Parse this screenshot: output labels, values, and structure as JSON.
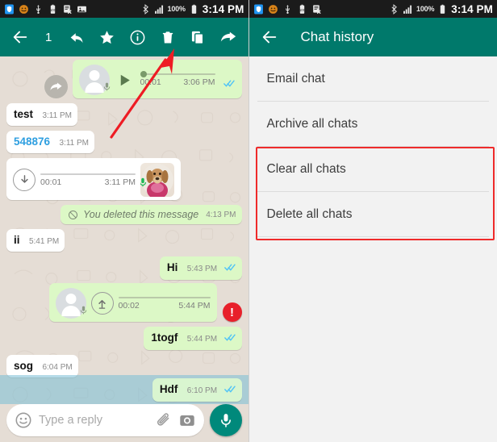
{
  "status_bar": {
    "battery_percent": "100%",
    "time": "3:14 PM",
    "icons_left": [
      "shield-icon",
      "smiley-icon",
      "usb-icon",
      "battery-saver-icon",
      "document-x-icon",
      "image-icon"
    ],
    "icons_right": [
      "bluetooth-icon",
      "signal-icon",
      "battery-icon"
    ]
  },
  "left_panel": {
    "action_bar": {
      "selected_count": "1",
      "icons": [
        "back-arrow-icon",
        "reply-icon",
        "star-icon",
        "info-icon",
        "delete-icon",
        "copy-icon",
        "forward-icon"
      ]
    },
    "accent_color": "#00796b",
    "messages": [
      {
        "id": "voice-out-1",
        "type": "voice-out",
        "forwarded": true,
        "duration": "00:01",
        "time": "3:06 PM",
        "status": "read"
      },
      {
        "id": "msg-test",
        "type": "text-in",
        "text": "test",
        "time": "3:11 PM"
      },
      {
        "id": "msg-548876",
        "type": "text-in-link",
        "text": "548876",
        "time": "3:11 PM"
      },
      {
        "id": "voice-in-1",
        "type": "voice-in",
        "duration": "00:01",
        "time": "3:11 PM",
        "avatar": "dog-photo-avatar"
      },
      {
        "id": "msg-deleted",
        "type": "deleted-out",
        "text": "You deleted this message",
        "time": "4:13 PM"
      },
      {
        "id": "msg-ii",
        "type": "text-in",
        "text": "ii",
        "time": "5:41 PM"
      },
      {
        "id": "msg-hi",
        "type": "text-out",
        "text": "Hi",
        "time": "5:43 PM",
        "status": "read"
      },
      {
        "id": "voice-out-2",
        "type": "voice-out-error",
        "duration": "00:02",
        "time": "5:44 PM",
        "error": "!"
      },
      {
        "id": "msg-1togf",
        "type": "text-out",
        "text": "1togf",
        "time": "5:44 PM",
        "status": "read"
      },
      {
        "id": "msg-sog",
        "type": "text-in",
        "text": "sog",
        "time": "6:04 PM"
      },
      {
        "id": "msg-hdf",
        "type": "text-out-selected",
        "text": "Hdf",
        "time": "6:10 PM",
        "status": "read"
      }
    ],
    "input_bar": {
      "placeholder": "Type a reply",
      "value": "",
      "emoji_icon": "emoji-icon",
      "attach_icon": "paperclip-icon",
      "camera_icon": "camera-icon",
      "mic_icon": "mic-icon"
    }
  },
  "right_panel": {
    "title": "Chat history",
    "back_icon": "back-arrow-icon",
    "menu_items": [
      {
        "label": "Email chat",
        "highlighted": false
      },
      {
        "label": "Archive all chats",
        "highlighted": false
      },
      {
        "label": "Clear all chats",
        "highlighted": true
      },
      {
        "label": "Delete all chats",
        "highlighted": true
      }
    ],
    "annotation_color": "#ef2b2b"
  }
}
